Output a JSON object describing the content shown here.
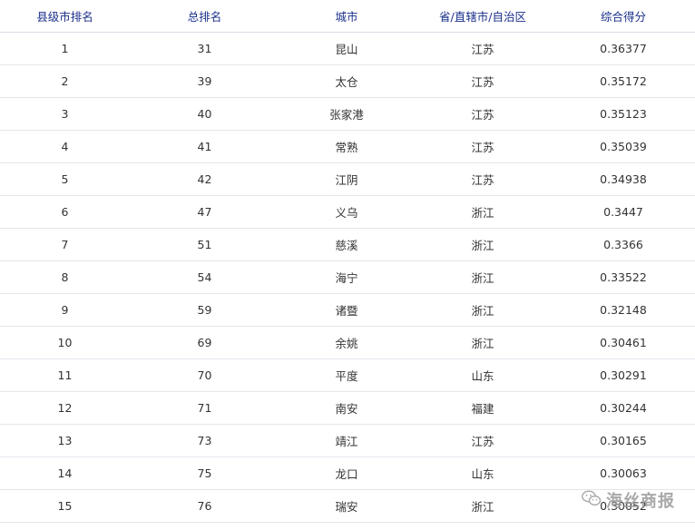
{
  "table": {
    "headers": [
      "县级市排名",
      "总排名",
      "城市",
      "省/直辖市/自治区",
      "综合得分"
    ],
    "rows": [
      [
        "1",
        "31",
        "昆山",
        "江苏",
        "0.36377"
      ],
      [
        "2",
        "39",
        "太仓",
        "江苏",
        "0.35172"
      ],
      [
        "3",
        "40",
        "张家港",
        "江苏",
        "0.35123"
      ],
      [
        "4",
        "41",
        "常熟",
        "江苏",
        "0.35039"
      ],
      [
        "5",
        "42",
        "江阴",
        "江苏",
        "0.34938"
      ],
      [
        "6",
        "47",
        "义乌",
        "浙江",
        "0.3447"
      ],
      [
        "7",
        "51",
        "慈溪",
        "浙江",
        "0.3366"
      ],
      [
        "8",
        "54",
        "海宁",
        "浙江",
        "0.33522"
      ],
      [
        "9",
        "59",
        "诸暨",
        "浙江",
        "0.32148"
      ],
      [
        "10",
        "69",
        "余姚",
        "浙江",
        "0.30461"
      ],
      [
        "11",
        "70",
        "平度",
        "山东",
        "0.30291"
      ],
      [
        "12",
        "71",
        "南安",
        "福建",
        "0.30244"
      ],
      [
        "13",
        "73",
        "靖江",
        "江苏",
        "0.30165"
      ],
      [
        "14",
        "75",
        "龙口",
        "山东",
        "0.30063"
      ],
      [
        "15",
        "76",
        "瑞安",
        "浙江",
        "0.30052"
      ]
    ]
  },
  "watermark": {
    "text": "海丝商报",
    "icon": "wechat-icon"
  }
}
